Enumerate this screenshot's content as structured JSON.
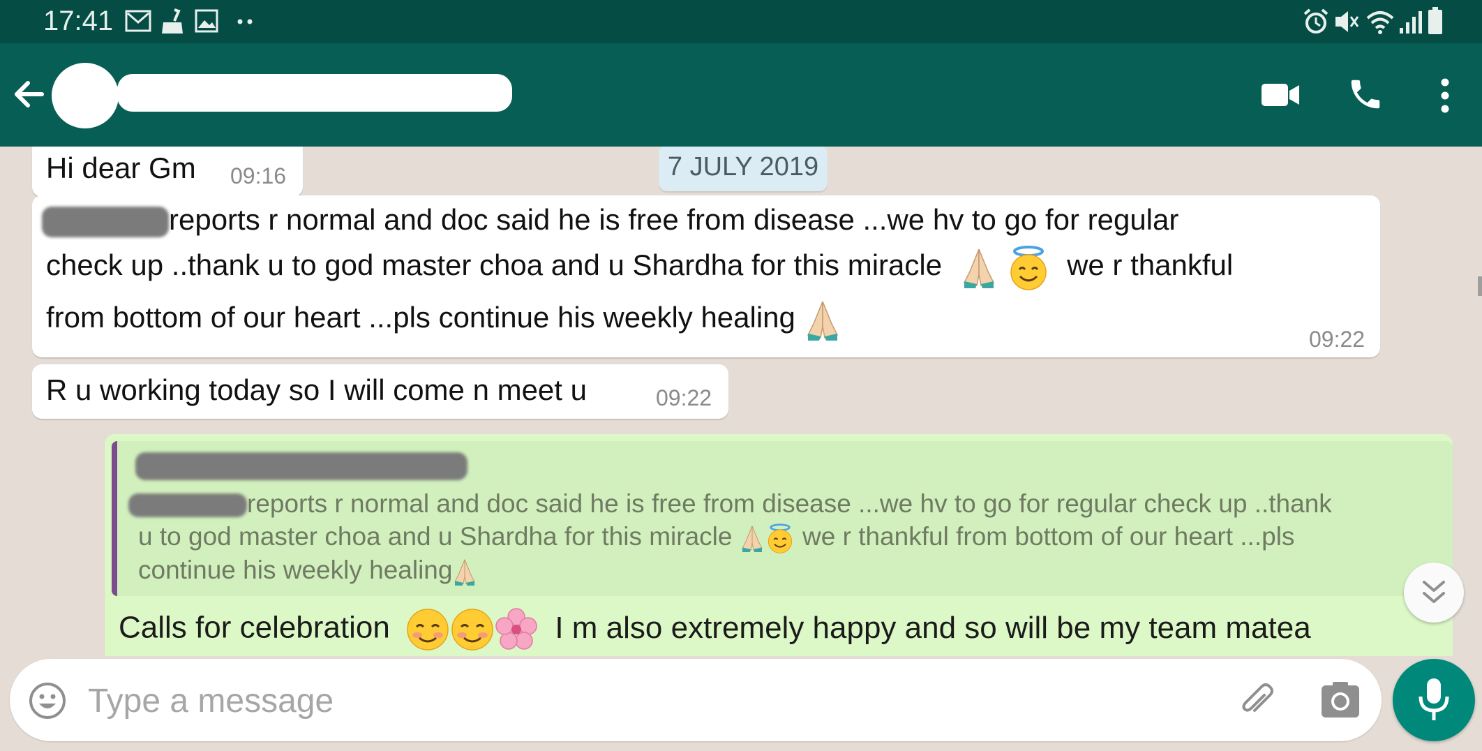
{
  "status_bar": {
    "time": "17:41",
    "left_icons": [
      "mail-icon",
      "cleaner-icon",
      "image-icon",
      "more-dots-icon"
    ],
    "right_icons": [
      "alarm-icon",
      "mute-icon",
      "wifi-icon",
      "signal-icon",
      "battery-icon"
    ]
  },
  "header": {
    "contact_name": "",
    "icons": [
      "back-arrow-icon",
      "avatar",
      "video-call-icon",
      "phone-icon",
      "menu-dots-icon"
    ]
  },
  "date_chip": "7 JULY 2019",
  "messages": [
    {
      "type": "incoming",
      "text": "Hi dear Gm",
      "time": "09:16"
    },
    {
      "type": "incoming",
      "line1": "reports r normal and doc said he is free from disease ...we hv to go for regular",
      "line2": "check up ..thank  u to god master choa and u Shardha for this miracle",
      "line2_end": "we r thankful",
      "line3": "from bottom of our heart ...pls continue his weekly healing",
      "time": "09:22"
    },
    {
      "type": "incoming",
      "text": "R u working today so I will come n meet u",
      "time": "09:22"
    },
    {
      "type": "outgoing",
      "quote": {
        "line1": "reports r normal and doc said he is free from disease ...we hv to go for regular check up ..thank",
        "line2": "u to god master choa and u Shardha for this miracle",
        "line2_end": "we r thankful from bottom of our heart ...pls",
        "line3": "continue his weekly healing"
      },
      "text_start": "Calls for celebration",
      "text_end": "I m also extremely happy and so will be my team matea"
    }
  ],
  "input": {
    "placeholder": "Type a message"
  },
  "colors": {
    "status_bar": "#054d44",
    "app_bar": "#075e54",
    "chat_background": "#e5ddd5",
    "incoming_bubble": "#ffffff",
    "outgoing_bubble": "#dcf8c6",
    "mic_button": "#00897b",
    "quote_bar": "#7b4d8f"
  }
}
